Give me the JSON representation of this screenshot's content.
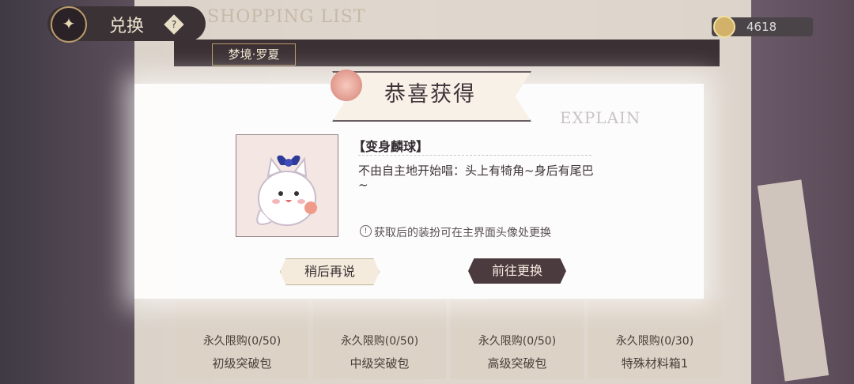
{
  "header": {
    "back_icon": "butterfly-emblem-icon",
    "title": "兑换",
    "help_icon": "help-diamond-icon",
    "shop_title": "SHOPPING LIST",
    "currency_icon": "coin-icon",
    "currency_value": "4618"
  },
  "tabs": {
    "active_label": "梦境·罗夏"
  },
  "background_cards": [
    {
      "limit": "永久限购(0/50)",
      "name": "初级突破包"
    },
    {
      "limit": "永久限购(0/50)",
      "name": "中级突破包"
    },
    {
      "limit": "永久限购(0/50)",
      "name": "高级突破包"
    },
    {
      "limit": "永久限购(0/30)",
      "name": "特殊材料箱1"
    }
  ],
  "background_side": {
    "explain": "EXPLAIN"
  },
  "dialog": {
    "title": "恭喜获得",
    "item_name": "【变身麟球】",
    "item_description": "不由自主地开始唱：头上有犄角~身后有尾巴~",
    "note_icon": "exclamation-circle-icon",
    "note": "获取后的装扮可在主界面头像处更换",
    "later_button": "稍后再说",
    "go_button": "前往更换"
  },
  "colors": {
    "dark_panel": "#3b3034",
    "accent_gold": "#b99c6c",
    "dialog_bg": "#ffffff",
    "button_dark": "#4b3b3f",
    "button_light": "#f4ebdc"
  }
}
